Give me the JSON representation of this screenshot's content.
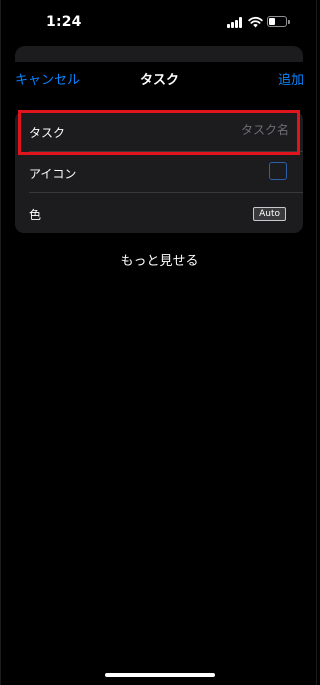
{
  "status_bar": {
    "time": "1:24",
    "battery_level": 0.35,
    "icons": [
      "cellular-signal-icon",
      "wifi-icon",
      "battery-icon"
    ]
  },
  "nav": {
    "cancel_label": "キャンセル",
    "title": "タスク",
    "add_label": "追加"
  },
  "form": {
    "task": {
      "label": "タスク",
      "placeholder": "タスク名",
      "value": ""
    },
    "icon": {
      "label": "アイコン",
      "icon": "icon-well"
    },
    "color": {
      "label": "色",
      "value": "Auto"
    }
  },
  "show_more_label": "もっと見せる",
  "colors": {
    "accent": "#0a84ff",
    "background": "#000000",
    "group_background": "#1c1c1e",
    "highlight": "#e0141c"
  }
}
